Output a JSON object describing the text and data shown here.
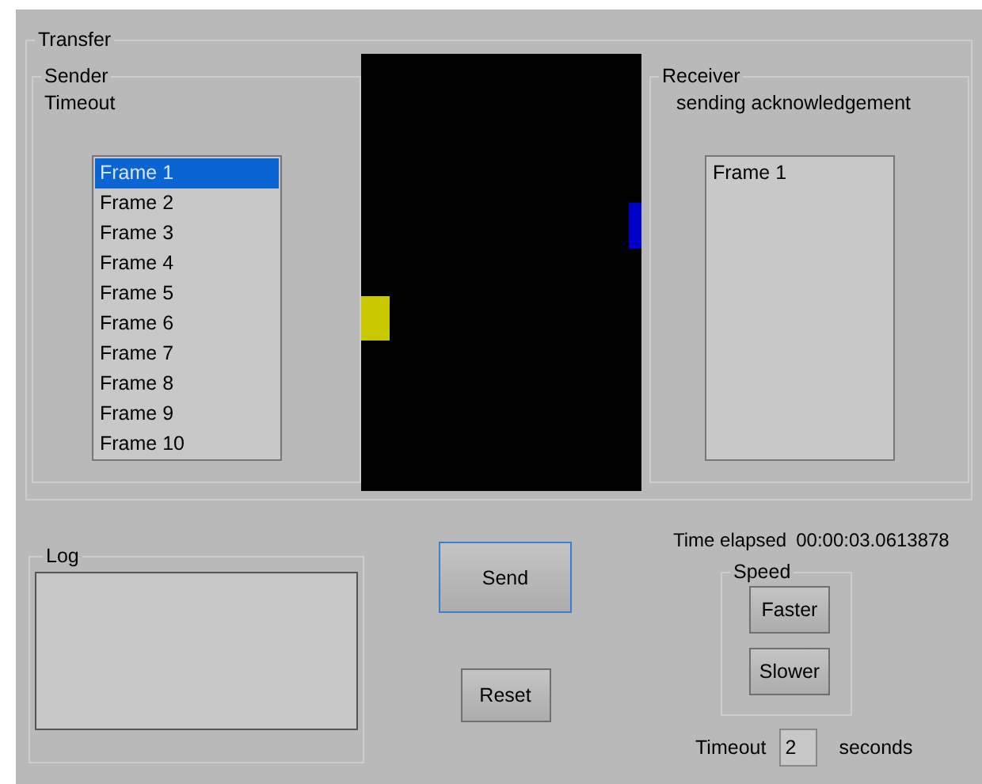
{
  "transfer": {
    "title": "Transfer",
    "sender": {
      "title": "Sender",
      "status": "Timeout",
      "frames": [
        {
          "label": "Frame 1",
          "selected": true
        },
        {
          "label": "Frame 2",
          "selected": false
        },
        {
          "label": "Frame 3",
          "selected": false
        },
        {
          "label": "Frame 4",
          "selected": false
        },
        {
          "label": "Frame 5",
          "selected": false
        },
        {
          "label": "Frame 6",
          "selected": false
        },
        {
          "label": "Frame 7",
          "selected": false
        },
        {
          "label": "Frame 8",
          "selected": false
        },
        {
          "label": "Frame 9",
          "selected": false
        },
        {
          "label": "Frame 10",
          "selected": false
        }
      ]
    },
    "channel": {
      "packets": [
        {
          "kind": "frame",
          "color": "#c8c800"
        },
        {
          "kind": "ack",
          "color": "#0000c8"
        }
      ]
    },
    "receiver": {
      "title": "Receiver",
      "status": "sending acknowledgement",
      "frames": [
        {
          "label": "Frame 1",
          "selected": false
        }
      ]
    }
  },
  "log": {
    "title": "Log"
  },
  "buttons": [
    {
      "label": "Send",
      "focused": true
    },
    {
      "label": "Reset",
      "focused": false
    }
  ],
  "time_elapsed": {
    "label": "Time elapsed",
    "value": "00:00:03.0613878"
  },
  "speed": {
    "title": "Speed",
    "buttons": [
      "Faster",
      "Slower"
    ]
  },
  "timeout": {
    "label": "Timeout",
    "value": "2",
    "unit": "seconds"
  }
}
